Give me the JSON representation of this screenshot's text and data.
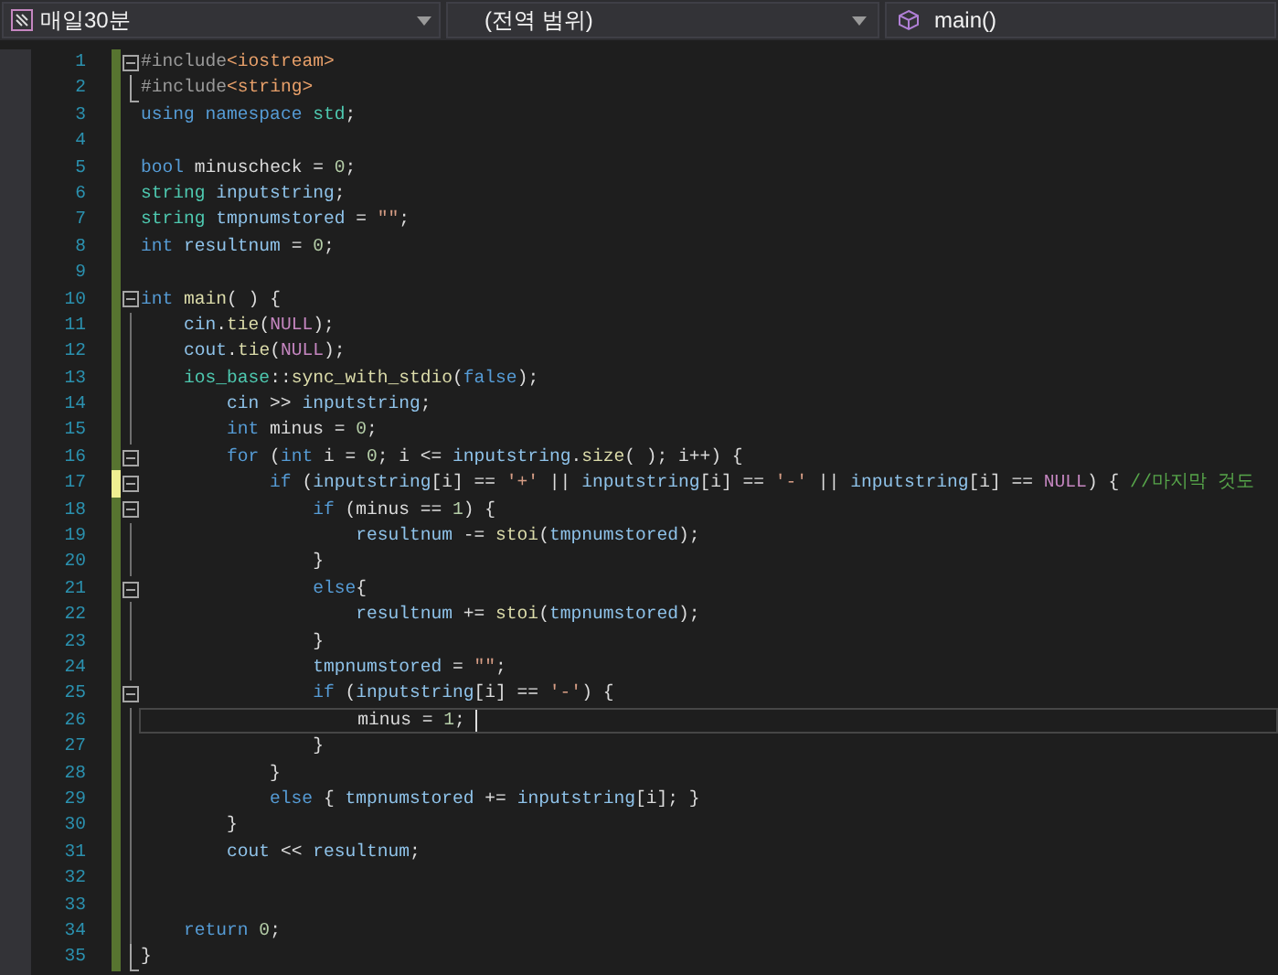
{
  "navigation_bar": {
    "project": "매일30분",
    "scope": "(전역 범위)",
    "member": "main()"
  },
  "lines": [
    {
      "number": "1",
      "kind": "start",
      "unsaved": false,
      "current": false,
      "tokens": [
        {
          "text": "#include",
          "kind": "preproc"
        },
        {
          "text": "<iostream>",
          "kind": "include"
        }
      ]
    },
    {
      "number": "2",
      "kind": "end",
      "unsaved": false,
      "current": false,
      "tokens": [
        {
          "text": "#include",
          "kind": "preproc"
        },
        {
          "text": "<string>",
          "kind": "include"
        }
      ]
    },
    {
      "number": "3",
      "kind": "plain",
      "unsaved": false,
      "current": false,
      "tokens": [
        {
          "text": "using",
          "kind": "keyword"
        },
        {
          "text": " namespace",
          "kind": "keyword"
        },
        {
          "text": " std",
          "kind": "type"
        },
        {
          "text": ";",
          "kind": "plain"
        }
      ]
    },
    {
      "number": "4",
      "kind": "plain",
      "unsaved": false,
      "current": false
    },
    {
      "number": "5",
      "kind": "plain",
      "unsaved": false,
      "current": false,
      "tokens": [
        {
          "text": "bool",
          "kind": "keyword"
        },
        {
          "text": " minuscheck = ",
          "kind": "plain"
        },
        {
          "text": "0",
          "kind": "number"
        },
        {
          "text": ";",
          "kind": "plain"
        }
      ]
    },
    {
      "number": "6",
      "kind": "plain",
      "unsaved": false,
      "current": false,
      "tokens": [
        {
          "text": "string",
          "kind": "type"
        },
        {
          "text": " inputstring",
          "kind": "global"
        },
        {
          "text": ";",
          "kind": "plain"
        }
      ]
    },
    {
      "number": "7",
      "kind": "plain",
      "unsaved": false,
      "current": false,
      "tokens": [
        {
          "text": "string",
          "kind": "type"
        },
        {
          "text": " tmpnumstored",
          "kind": "global"
        },
        {
          "text": " = ",
          "kind": "plain"
        },
        {
          "text": "\"\"",
          "kind": "string"
        },
        {
          "text": ";",
          "kind": "plain"
        }
      ]
    },
    {
      "number": "8",
      "kind": "plain",
      "unsaved": false,
      "current": false,
      "tokens": [
        {
          "text": "int",
          "kind": "keyword"
        },
        {
          "text": " resultnum",
          "kind": "global"
        },
        {
          "text": " = ",
          "kind": "plain"
        },
        {
          "text": "0",
          "kind": "number"
        },
        {
          "text": ";",
          "kind": "plain"
        }
      ]
    },
    {
      "number": "9",
      "kind": "plain",
      "unsaved": false,
      "current": false
    },
    {
      "number": "10",
      "kind": "start",
      "unsaved": false,
      "current": false,
      "tokens": [
        {
          "text": "int",
          "kind": "keyword"
        },
        {
          "text": " main",
          "kind": "function"
        },
        {
          "text": "( ) {",
          "kind": "plain"
        }
      ]
    },
    {
      "number": "11",
      "kind": "inside",
      "unsaved": false,
      "current": false,
      "tokens": [
        {
          "text": "    cin",
          "kind": "global"
        },
        {
          "text": ".",
          "kind": "plain"
        },
        {
          "text": "tie",
          "kind": "function"
        },
        {
          "text": "(",
          "kind": "plain"
        },
        {
          "text": "NULL",
          "kind": "macro"
        },
        {
          "text": ");",
          "kind": "plain"
        }
      ]
    },
    {
      "number": "12",
      "kind": "inside",
      "unsaved": false,
      "current": false,
      "tokens": [
        {
          "text": "    cout",
          "kind": "global"
        },
        {
          "text": ".",
          "kind": "plain"
        },
        {
          "text": "tie",
          "kind": "function"
        },
        {
          "text": "(",
          "kind": "plain"
        },
        {
          "text": "NULL",
          "kind": "macro"
        },
        {
          "text": ");",
          "kind": "plain"
        }
      ]
    },
    {
      "number": "13",
      "kind": "inside",
      "unsaved": false,
      "current": false,
      "tokens": [
        {
          "text": "    ios_base",
          "kind": "type"
        },
        {
          "text": "::",
          "kind": "plain"
        },
        {
          "text": "sync_with_stdio",
          "kind": "function"
        },
        {
          "text": "(",
          "kind": "plain"
        },
        {
          "text": "false",
          "kind": "keyword"
        },
        {
          "text": ");",
          "kind": "plain"
        }
      ]
    },
    {
      "number": "14",
      "kind": "inside",
      "unsaved": false,
      "current": false,
      "tokens": [
        {
          "text": "        cin",
          "kind": "global"
        },
        {
          "text": " >> ",
          "kind": "plain"
        },
        {
          "text": "inputstring",
          "kind": "global"
        },
        {
          "text": ";",
          "kind": "plain"
        }
      ]
    },
    {
      "number": "15",
      "kind": "inside",
      "unsaved": false,
      "current": false,
      "tokens": [
        {
          "text": "        int",
          "kind": "keyword"
        },
        {
          "text": " minus = ",
          "kind": "plain"
        },
        {
          "text": "0",
          "kind": "number"
        },
        {
          "text": ";",
          "kind": "plain"
        }
      ]
    },
    {
      "number": "16",
      "kind": "start",
      "unsaved": false,
      "current": false,
      "tokens": [
        {
          "text": "        for",
          "kind": "keyword"
        },
        {
          "text": " (",
          "kind": "plain"
        },
        {
          "text": "int",
          "kind": "keyword"
        },
        {
          "text": " i = ",
          "kind": "plain"
        },
        {
          "text": "0",
          "kind": "number"
        },
        {
          "text": "; i <= ",
          "kind": "plain"
        },
        {
          "text": "inputstring",
          "kind": "global"
        },
        {
          "text": ".",
          "kind": "plain"
        },
        {
          "text": "size",
          "kind": "function"
        },
        {
          "text": "( ); i++) {",
          "kind": "plain"
        }
      ]
    },
    {
      "number": "17",
      "kind": "start",
      "unsaved": true,
      "current": false,
      "tokens": [
        {
          "text": "            if",
          "kind": "keyword"
        },
        {
          "text": " (",
          "kind": "plain"
        },
        {
          "text": "inputstring",
          "kind": "global"
        },
        {
          "text": "[i] == ",
          "kind": "plain"
        },
        {
          "text": "'+'",
          "kind": "string"
        },
        {
          "text": " || ",
          "kind": "plain"
        },
        {
          "text": "inputstring",
          "kind": "global"
        },
        {
          "text": "[i] == ",
          "kind": "plain"
        },
        {
          "text": "'-'",
          "kind": "string"
        },
        {
          "text": " || ",
          "kind": "plain"
        },
        {
          "text": "inputstring",
          "kind": "global"
        },
        {
          "text": "[i] == ",
          "kind": "plain"
        },
        {
          "text": "NULL",
          "kind": "macro"
        },
        {
          "text": ") { ",
          "kind": "plain"
        },
        {
          "text": "//마지막 것도",
          "kind": "comment"
        }
      ]
    },
    {
      "number": "18",
      "kind": "start",
      "unsaved": false,
      "current": false,
      "tokens": [
        {
          "text": "                if",
          "kind": "keyword"
        },
        {
          "text": " (minus == ",
          "kind": "plain"
        },
        {
          "text": "1",
          "kind": "number"
        },
        {
          "text": ") {",
          "kind": "plain"
        }
      ]
    },
    {
      "number": "19",
      "kind": "inside",
      "unsaved": false,
      "current": false,
      "tokens": [
        {
          "text": "                    resultnum",
          "kind": "global"
        },
        {
          "text": " -= ",
          "kind": "plain"
        },
        {
          "text": "stoi",
          "kind": "function"
        },
        {
          "text": "(",
          "kind": "plain"
        },
        {
          "text": "tmpnumstored",
          "kind": "global"
        },
        {
          "text": ");",
          "kind": "plain"
        }
      ]
    },
    {
      "number": "20",
      "kind": "inside",
      "unsaved": false,
      "current": false,
      "tokens": [
        {
          "text": "                }",
          "kind": "plain"
        }
      ]
    },
    {
      "number": "21",
      "kind": "start",
      "unsaved": false,
      "current": false,
      "tokens": [
        {
          "text": "                else",
          "kind": "keyword"
        },
        {
          "text": "{",
          "kind": "plain"
        }
      ]
    },
    {
      "number": "22",
      "kind": "inside",
      "unsaved": false,
      "current": false,
      "tokens": [
        {
          "text": "                    resultnum",
          "kind": "global"
        },
        {
          "text": " += ",
          "kind": "plain"
        },
        {
          "text": "stoi",
          "kind": "function"
        },
        {
          "text": "(",
          "kind": "plain"
        },
        {
          "text": "tmpnumstored",
          "kind": "global"
        },
        {
          "text": ");",
          "kind": "plain"
        }
      ]
    },
    {
      "number": "23",
      "kind": "inside",
      "unsaved": false,
      "current": false,
      "tokens": [
        {
          "text": "                }",
          "kind": "plain"
        }
      ]
    },
    {
      "number": "24",
      "kind": "inside",
      "unsaved": false,
      "current": false,
      "tokens": [
        {
          "text": "                tmpnumstored",
          "kind": "global"
        },
        {
          "text": " = ",
          "kind": "plain"
        },
        {
          "text": "\"\"",
          "kind": "string"
        },
        {
          "text": ";",
          "kind": "plain"
        }
      ]
    },
    {
      "number": "25",
      "kind": "start",
      "unsaved": false,
      "current": false,
      "tokens": [
        {
          "text": "                if",
          "kind": "keyword"
        },
        {
          "text": " (",
          "kind": "plain"
        },
        {
          "text": "inputstring",
          "kind": "global"
        },
        {
          "text": "[i] == ",
          "kind": "plain"
        },
        {
          "text": "'-'",
          "kind": "string"
        },
        {
          "text": ") {",
          "kind": "plain"
        }
      ]
    },
    {
      "number": "26",
      "kind": "inside",
      "unsaved": false,
      "current": true,
      "tokens": [
        {
          "text": "                    minus = ",
          "kind": "plain"
        },
        {
          "text": "1",
          "kind": "number"
        },
        {
          "text": ";",
          "kind": "plain"
        }
      ]
    },
    {
      "number": "27",
      "kind": "inside",
      "unsaved": false,
      "current": false,
      "tokens": [
        {
          "text": "                }",
          "kind": "plain"
        }
      ]
    },
    {
      "number": "28",
      "kind": "inside",
      "unsaved": false,
      "current": false,
      "tokens": [
        {
          "text": "            }",
          "kind": "plain"
        }
      ]
    },
    {
      "number": "29",
      "kind": "inside",
      "unsaved": false,
      "current": false,
      "tokens": [
        {
          "text": "            else",
          "kind": "keyword"
        },
        {
          "text": " { ",
          "kind": "plain"
        },
        {
          "text": "tmpnumstored",
          "kind": "global"
        },
        {
          "text": " += ",
          "kind": "plain"
        },
        {
          "text": "inputstring",
          "kind": "global"
        },
        {
          "text": "[i]; }",
          "kind": "plain"
        }
      ]
    },
    {
      "number": "30",
      "kind": "inside",
      "unsaved": false,
      "current": false,
      "tokens": [
        {
          "text": "        }",
          "kind": "plain"
        }
      ]
    },
    {
      "number": "31",
      "kind": "inside",
      "unsaved": false,
      "current": false,
      "tokens": [
        {
          "text": "        cout",
          "kind": "global"
        },
        {
          "text": " << ",
          "kind": "plain"
        },
        {
          "text": "resultnum",
          "kind": "global"
        },
        {
          "text": ";",
          "kind": "plain"
        }
      ]
    },
    {
      "number": "32",
      "kind": "inside",
      "unsaved": false,
      "current": false
    },
    {
      "number": "33",
      "kind": "inside",
      "unsaved": false,
      "current": false
    },
    {
      "number": "34",
      "kind": "inside",
      "unsaved": false,
      "current": false,
      "tokens": [
        {
          "text": "    return",
          "kind": "keyword"
        },
        {
          "text": " 0",
          "kind": "number"
        },
        {
          "text": ";",
          "kind": "plain"
        }
      ]
    },
    {
      "number": "35",
      "kind": "end",
      "unsaved": false,
      "current": false,
      "tokens": [
        {
          "text": "}",
          "kind": "plain"
        }
      ]
    }
  ]
}
